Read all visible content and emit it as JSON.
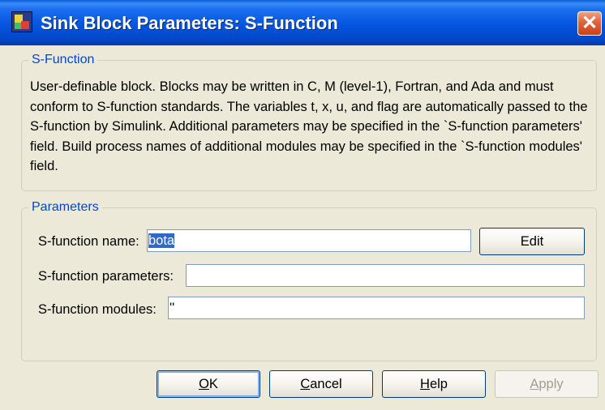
{
  "window": {
    "title": "Sink Block Parameters: S-Function",
    "close_glyph": "✕"
  },
  "description_group": {
    "legend": "S-Function",
    "text": "User-definable block.  Blocks may be written in C, M (level-1), Fortran, and Ada and must conform to S-function standards.  The variables t, x, u, and flag are automatically passed to the S-function by Simulink. Additional parameters may be specified in the `S-function parameters' field. Build process names of additional modules may be specified in the `S-function modules' field."
  },
  "parameters_group": {
    "legend": "Parameters",
    "name_label": "S-function name:",
    "name_value": "bota",
    "edit_button": "Edit",
    "params_label": "S-function parameters:",
    "params_value": "",
    "modules_label": "S-function modules:",
    "modules_value": "''"
  },
  "buttons": {
    "ok": {
      "mnemonic": "O",
      "rest": "K"
    },
    "cancel": {
      "mnemonic": "C",
      "rest": "ancel"
    },
    "help": {
      "mnemonic": "H",
      "rest": "elp"
    },
    "apply": {
      "mnemonic": "A",
      "rest": "pply"
    }
  },
  "icons": {
    "title_icon": "simulink-block-icon",
    "close_icon": "close-x-icon"
  },
  "colors": {
    "titlebar": "#0455e0",
    "legend_text": "#0046d5",
    "selection": "#316ac5",
    "close_button": "#e2613a"
  }
}
